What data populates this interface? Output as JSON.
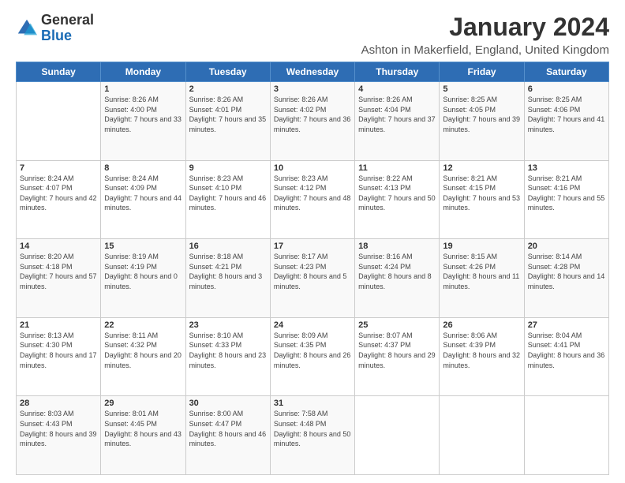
{
  "header": {
    "logo_general": "General",
    "logo_blue": "Blue",
    "month_title": "January 2024",
    "location": "Ashton in Makerfield, England, United Kingdom"
  },
  "days_of_week": [
    "Sunday",
    "Monday",
    "Tuesday",
    "Wednesday",
    "Thursday",
    "Friday",
    "Saturday"
  ],
  "weeks": [
    [
      {
        "day": "",
        "sunrise": "",
        "sunset": "",
        "daylight": ""
      },
      {
        "day": "1",
        "sunrise": "Sunrise: 8:26 AM",
        "sunset": "Sunset: 4:00 PM",
        "daylight": "Daylight: 7 hours and 33 minutes."
      },
      {
        "day": "2",
        "sunrise": "Sunrise: 8:26 AM",
        "sunset": "Sunset: 4:01 PM",
        "daylight": "Daylight: 7 hours and 35 minutes."
      },
      {
        "day": "3",
        "sunrise": "Sunrise: 8:26 AM",
        "sunset": "Sunset: 4:02 PM",
        "daylight": "Daylight: 7 hours and 36 minutes."
      },
      {
        "day": "4",
        "sunrise": "Sunrise: 8:26 AM",
        "sunset": "Sunset: 4:04 PM",
        "daylight": "Daylight: 7 hours and 37 minutes."
      },
      {
        "day": "5",
        "sunrise": "Sunrise: 8:25 AM",
        "sunset": "Sunset: 4:05 PM",
        "daylight": "Daylight: 7 hours and 39 minutes."
      },
      {
        "day": "6",
        "sunrise": "Sunrise: 8:25 AM",
        "sunset": "Sunset: 4:06 PM",
        "daylight": "Daylight: 7 hours and 41 minutes."
      }
    ],
    [
      {
        "day": "7",
        "sunrise": "Sunrise: 8:24 AM",
        "sunset": "Sunset: 4:07 PM",
        "daylight": "Daylight: 7 hours and 42 minutes."
      },
      {
        "day": "8",
        "sunrise": "Sunrise: 8:24 AM",
        "sunset": "Sunset: 4:09 PM",
        "daylight": "Daylight: 7 hours and 44 minutes."
      },
      {
        "day": "9",
        "sunrise": "Sunrise: 8:23 AM",
        "sunset": "Sunset: 4:10 PM",
        "daylight": "Daylight: 7 hours and 46 minutes."
      },
      {
        "day": "10",
        "sunrise": "Sunrise: 8:23 AM",
        "sunset": "Sunset: 4:12 PM",
        "daylight": "Daylight: 7 hours and 48 minutes."
      },
      {
        "day": "11",
        "sunrise": "Sunrise: 8:22 AM",
        "sunset": "Sunset: 4:13 PM",
        "daylight": "Daylight: 7 hours and 50 minutes."
      },
      {
        "day": "12",
        "sunrise": "Sunrise: 8:21 AM",
        "sunset": "Sunset: 4:15 PM",
        "daylight": "Daylight: 7 hours and 53 minutes."
      },
      {
        "day": "13",
        "sunrise": "Sunrise: 8:21 AM",
        "sunset": "Sunset: 4:16 PM",
        "daylight": "Daylight: 7 hours and 55 minutes."
      }
    ],
    [
      {
        "day": "14",
        "sunrise": "Sunrise: 8:20 AM",
        "sunset": "Sunset: 4:18 PM",
        "daylight": "Daylight: 7 hours and 57 minutes."
      },
      {
        "day": "15",
        "sunrise": "Sunrise: 8:19 AM",
        "sunset": "Sunset: 4:19 PM",
        "daylight": "Daylight: 8 hours and 0 minutes."
      },
      {
        "day": "16",
        "sunrise": "Sunrise: 8:18 AM",
        "sunset": "Sunset: 4:21 PM",
        "daylight": "Daylight: 8 hours and 3 minutes."
      },
      {
        "day": "17",
        "sunrise": "Sunrise: 8:17 AM",
        "sunset": "Sunset: 4:23 PM",
        "daylight": "Daylight: 8 hours and 5 minutes."
      },
      {
        "day": "18",
        "sunrise": "Sunrise: 8:16 AM",
        "sunset": "Sunset: 4:24 PM",
        "daylight": "Daylight: 8 hours and 8 minutes."
      },
      {
        "day": "19",
        "sunrise": "Sunrise: 8:15 AM",
        "sunset": "Sunset: 4:26 PM",
        "daylight": "Daylight: 8 hours and 11 minutes."
      },
      {
        "day": "20",
        "sunrise": "Sunrise: 8:14 AM",
        "sunset": "Sunset: 4:28 PM",
        "daylight": "Daylight: 8 hours and 14 minutes."
      }
    ],
    [
      {
        "day": "21",
        "sunrise": "Sunrise: 8:13 AM",
        "sunset": "Sunset: 4:30 PM",
        "daylight": "Daylight: 8 hours and 17 minutes."
      },
      {
        "day": "22",
        "sunrise": "Sunrise: 8:11 AM",
        "sunset": "Sunset: 4:32 PM",
        "daylight": "Daylight: 8 hours and 20 minutes."
      },
      {
        "day": "23",
        "sunrise": "Sunrise: 8:10 AM",
        "sunset": "Sunset: 4:33 PM",
        "daylight": "Daylight: 8 hours and 23 minutes."
      },
      {
        "day": "24",
        "sunrise": "Sunrise: 8:09 AM",
        "sunset": "Sunset: 4:35 PM",
        "daylight": "Daylight: 8 hours and 26 minutes."
      },
      {
        "day": "25",
        "sunrise": "Sunrise: 8:07 AM",
        "sunset": "Sunset: 4:37 PM",
        "daylight": "Daylight: 8 hours and 29 minutes."
      },
      {
        "day": "26",
        "sunrise": "Sunrise: 8:06 AM",
        "sunset": "Sunset: 4:39 PM",
        "daylight": "Daylight: 8 hours and 32 minutes."
      },
      {
        "day": "27",
        "sunrise": "Sunrise: 8:04 AM",
        "sunset": "Sunset: 4:41 PM",
        "daylight": "Daylight: 8 hours and 36 minutes."
      }
    ],
    [
      {
        "day": "28",
        "sunrise": "Sunrise: 8:03 AM",
        "sunset": "Sunset: 4:43 PM",
        "daylight": "Daylight: 8 hours and 39 minutes."
      },
      {
        "day": "29",
        "sunrise": "Sunrise: 8:01 AM",
        "sunset": "Sunset: 4:45 PM",
        "daylight": "Daylight: 8 hours and 43 minutes."
      },
      {
        "day": "30",
        "sunrise": "Sunrise: 8:00 AM",
        "sunset": "Sunset: 4:47 PM",
        "daylight": "Daylight: 8 hours and 46 minutes."
      },
      {
        "day": "31",
        "sunrise": "Sunrise: 7:58 AM",
        "sunset": "Sunset: 4:48 PM",
        "daylight": "Daylight: 8 hours and 50 minutes."
      },
      {
        "day": "",
        "sunrise": "",
        "sunset": "",
        "daylight": ""
      },
      {
        "day": "",
        "sunrise": "",
        "sunset": "",
        "daylight": ""
      },
      {
        "day": "",
        "sunrise": "",
        "sunset": "",
        "daylight": ""
      }
    ]
  ]
}
